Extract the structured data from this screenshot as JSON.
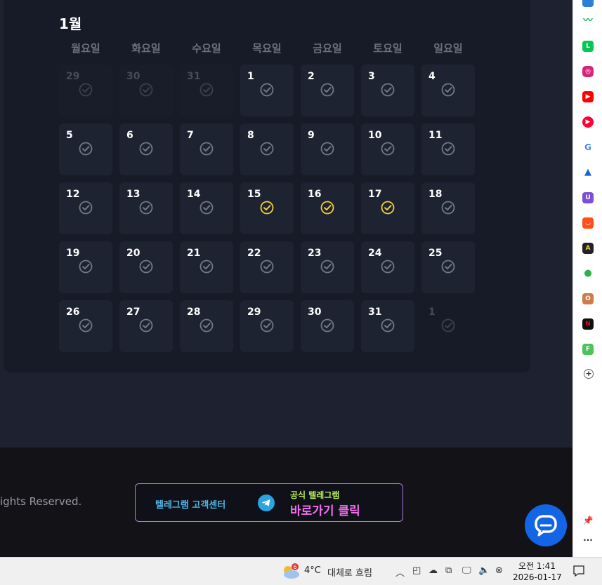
{
  "calendar": {
    "month": "1월",
    "weekdays": [
      "월요일",
      "화요일",
      "수요일",
      "목요일",
      "금요일",
      "토요일",
      "일요일"
    ],
    "weeks": [
      [
        {
          "d": "29",
          "muted": true
        },
        {
          "d": "30",
          "muted": true
        },
        {
          "d": "31",
          "muted": true
        },
        {
          "d": "1",
          "muted": false
        },
        {
          "d": "2",
          "muted": false
        },
        {
          "d": "3",
          "muted": false
        },
        {
          "d": "4",
          "muted": false
        }
      ],
      [
        {
          "d": "5",
          "muted": false
        },
        {
          "d": "6",
          "muted": false
        },
        {
          "d": "7",
          "muted": false
        },
        {
          "d": "8",
          "muted": false
        },
        {
          "d": "9",
          "muted": false
        },
        {
          "d": "10",
          "muted": false
        },
        {
          "d": "11",
          "muted": false
        }
      ],
      [
        {
          "d": "12",
          "muted": false
        },
        {
          "d": "13",
          "muted": false
        },
        {
          "d": "14",
          "muted": false
        },
        {
          "d": "15",
          "muted": false,
          "checked": true
        },
        {
          "d": "16",
          "muted": false,
          "checked": true
        },
        {
          "d": "17",
          "muted": false,
          "checked": true
        },
        {
          "d": "18",
          "muted": false
        }
      ],
      [
        {
          "d": "19",
          "muted": false
        },
        {
          "d": "20",
          "muted": false
        },
        {
          "d": "21",
          "muted": false
        },
        {
          "d": "22",
          "muted": false
        },
        {
          "d": "23",
          "muted": false
        },
        {
          "d": "24",
          "muted": false
        },
        {
          "d": "25",
          "muted": false
        }
      ],
      [
        {
          "d": "26",
          "muted": false
        },
        {
          "d": "27",
          "muted": false
        },
        {
          "d": "28",
          "muted": false
        },
        {
          "d": "29",
          "muted": false
        },
        {
          "d": "30",
          "muted": false
        },
        {
          "d": "31",
          "muted": false
        },
        {
          "d": "1",
          "muted": true,
          "blank": true
        }
      ]
    ],
    "colors": {
      "checked": "#f5cc3c",
      "unchecked": "#737885",
      "muted": "#3a404d"
    }
  },
  "footer": {
    "copyright": "ights Reserved.",
    "banner": {
      "left_text": "텔레그램 고객센터",
      "right_line1": "공식 텔레그램",
      "right_line2": "바로가기 클릭"
    }
  },
  "sidebar": {
    "icons": [
      "edge-icon",
      "stock-chart-icon",
      "line-icon",
      "instagram-icon",
      "youtube-icon",
      "youtube-music-icon",
      "google-icon",
      "mountain-icon",
      "u-icon",
      "aliexpress-icon",
      "alert-icon",
      "leaf-icon",
      "o-icon",
      "netflix-icon",
      "f-icon",
      "add-icon"
    ]
  },
  "taskbar": {
    "weather_badge": "6",
    "temperature": "4°C",
    "weather_text": "대체로 흐림",
    "time": "오전 1:41",
    "date": "2026-01-17"
  }
}
